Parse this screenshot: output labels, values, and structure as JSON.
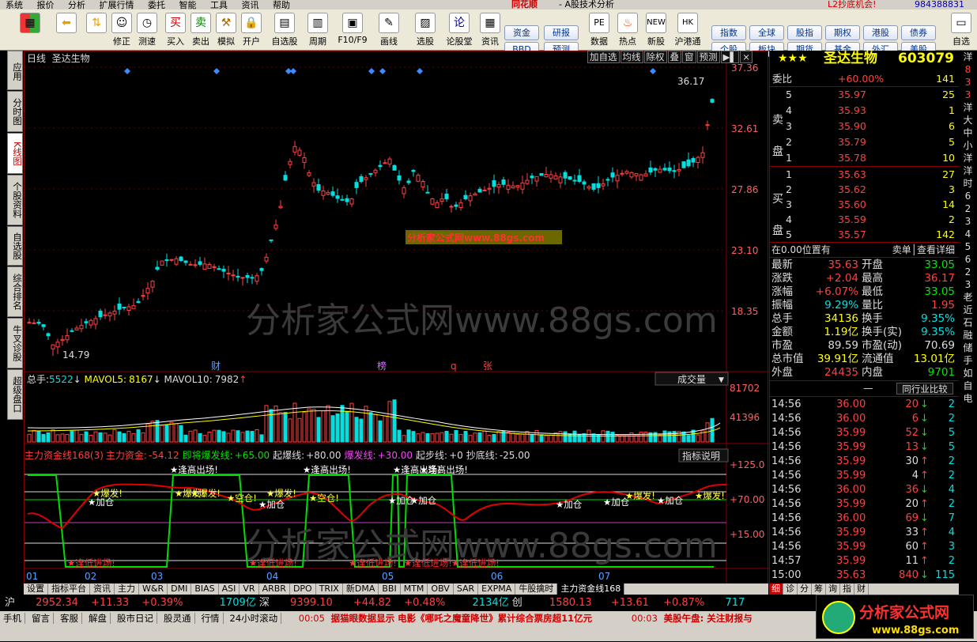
{
  "menubar": {
    "items": [
      "系统",
      "报价",
      "分析",
      "扩展行情",
      "委托",
      "智能",
      "工具",
      "资讯",
      "帮助"
    ],
    "app_title": "同花顺",
    "app_sub": "- A股技术分析",
    "promo": "L2抄底机会!",
    "phone": "984388831"
  },
  "toolbar": {
    "buttons": [
      "",
      "",
      "修正",
      "测速",
      "买入",
      "卖出",
      "模拟",
      "开户",
      "自选股",
      "周期",
      "F10/F9",
      "画线",
      "选股",
      "论股堂",
      "资讯",
      "数据",
      "热点",
      "新股",
      "沪港通",
      "自选"
    ],
    "small_buttons": [
      "资金",
      "研报",
      "BBD",
      "预测",
      "指数",
      "全球",
      "股指",
      "期权",
      "港股",
      "债券",
      "个股",
      "板块",
      "期货",
      "基金",
      "外汇",
      "美股"
    ]
  },
  "left_tabs": [
    "应用",
    "分时图",
    "K线图",
    "个股资料",
    "自选股",
    "综合排名",
    "牛叉诊股",
    "超级盘口"
  ],
  "chart": {
    "period": "日线",
    "stock_name": "圣达生物",
    "buttons": [
      "加自选",
      "均线",
      "除权",
      "叠",
      "窗",
      "预测"
    ],
    "price_axis": [
      "37.36",
      "32.61",
      "27.86",
      "23.10",
      "18.35"
    ],
    "high_label": "36.17",
    "low_label": "14.79",
    "event_tags": [
      "财",
      "榜",
      "q",
      "张"
    ],
    "watermark_small": "分析家公式网www.88gs.com",
    "watermark_big": "分析家公式网www.88gs.com",
    "volume_header": {
      "total_label": "总手:",
      "total": "5522",
      "ma5_label": "MAVOL5:",
      "ma5": "8167",
      "ma10_label": "MAVOL10:",
      "ma10": "7982"
    },
    "volume_dropdown": "成交量",
    "volume_axis": [
      "81702",
      "41396"
    ],
    "indicator_header": {
      "name": "主力资金线168(3)",
      "fund_label": "主力资金:",
      "fund": "-54.12",
      "about_label": "即将爆发线:",
      "about": "+65.00",
      "start_label": "起爆线:",
      "start": "+80.00",
      "burst_label": "爆发线:",
      "burst": "+30.00",
      "step_label": "起步线:",
      "step": "+0",
      "bottom_label": "抄底线:",
      "bottom": "-25.00"
    },
    "indicator_btn": "指标说明",
    "indicator_axis": [
      "+125.0",
      "+70.00",
      "+15.00"
    ],
    "signals": {
      "exit": "★逢高出场!",
      "enter": "★逢低进场!",
      "burst": "★爆发!",
      "add": "★加仓",
      "empty": "★空仓!"
    },
    "months": [
      "01",
      "02",
      "03",
      "04",
      "05",
      "06",
      "07"
    ]
  },
  "quote": {
    "stars": "★★★",
    "name": "圣达生物",
    "code": "603079",
    "weibi_label": "委比",
    "weibi": "+60.00%",
    "weibi_vol": "141",
    "sell_label": "卖盘",
    "buy_label": "买盘",
    "sells": [
      [
        "5",
        "35.97",
        "25"
      ],
      [
        "4",
        "35.93",
        "1"
      ],
      [
        "3",
        "35.90",
        "6"
      ],
      [
        "2",
        "35.79",
        "5"
      ],
      [
        "1",
        "35.78",
        "10"
      ]
    ],
    "buys": [
      [
        "1",
        "35.63",
        "27"
      ],
      [
        "2",
        "35.62",
        "3"
      ],
      [
        "3",
        "35.60",
        "14"
      ],
      [
        "4",
        "35.59",
        "2"
      ],
      [
        "5",
        "35.57",
        "142"
      ]
    ],
    "position_text": "在0.00位置有",
    "detail_text": "卖单│查看详细",
    "stats": [
      [
        "最新",
        "35.63",
        "开盘",
        "33.05"
      ],
      [
        "涨跌",
        "+2.04",
        "最高",
        "36.17"
      ],
      [
        "涨幅",
        "+6.07%",
        "最低",
        "33.05"
      ],
      [
        "振幅",
        "9.29%",
        "量比",
        "1.95"
      ],
      [
        "总手",
        "34136",
        "换手",
        "9.35%"
      ],
      [
        "金额",
        "1.19亿",
        "换手(实)",
        "9.35%"
      ],
      [
        "市盈",
        "89.59",
        "市盈(动)",
        "70.69"
      ],
      [
        "总市值",
        "39.91亿",
        "流通值",
        "13.01亿"
      ],
      [
        "外盘",
        "24435",
        "内盘",
        "9701"
      ]
    ],
    "industry_btn": "同行业比较",
    "ticks": [
      [
        "14:56",
        "36.00",
        "20",
        "↓",
        "2"
      ],
      [
        "14:56",
        "36.00",
        "6",
        "↓",
        "2"
      ],
      [
        "14:56",
        "35.99",
        "52",
        "↓",
        "5"
      ],
      [
        "14:56",
        "35.99",
        "13",
        "↓",
        "5"
      ],
      [
        "14:56",
        "35.99",
        "30",
        "↑",
        "2"
      ],
      [
        "14:56",
        "35.99",
        "4",
        "↑",
        "2"
      ],
      [
        "14:56",
        "36.00",
        "36",
        "↓",
        "4"
      ],
      [
        "14:56",
        "35.99",
        "20",
        "↑",
        "2"
      ],
      [
        "14:56",
        "36.00",
        "69",
        "↓",
        "7"
      ],
      [
        "14:56",
        "35.99",
        "33",
        "↑",
        "4"
      ],
      [
        "14:56",
        "35.99",
        "60",
        "↑",
        "3"
      ],
      [
        "14:57",
        "35.99",
        "11",
        "↑",
        "2"
      ],
      [
        "15:00",
        "35.63",
        "840",
        "↓",
        "115"
      ]
    ]
  },
  "scroll_col": [
    "洋",
    "8",
    "3",
    "3",
    "洋",
    "大",
    "中",
    "小",
    "洋",
    "洋",
    "时",
    "6",
    "2",
    "3",
    "4",
    "5",
    "6",
    "2",
    "3",
    "老",
    "近",
    "石",
    "融",
    "储",
    "手",
    "如",
    "自",
    "电"
  ],
  "bottom_tabs": [
    "设置",
    "指标平台",
    "资讯",
    "主力",
    "W&R",
    "DMI",
    "BIAS",
    "ASI",
    "VR",
    "ARBR",
    "DPO",
    "TRIX",
    "新DMA",
    "BBI",
    "MTM",
    "OBV",
    "SAR",
    "EXPMA",
    "牛股擒时",
    "主力资金线168"
  ],
  "right_tabs": [
    "细",
    "诊",
    "分",
    "筹",
    "询",
    "指",
    "财"
  ],
  "status1": {
    "sh": "沪",
    "sh_val": "2952.34",
    "sh_chg": "+11.33",
    "sh_pct": "+0.39%",
    "sh_amt": "1709亿",
    "sz": "深",
    "sz_val": "9399.10",
    "sz_chg": "+44.82",
    "sz_pct": "+0.48%",
    "sz_amt": "2134亿",
    "cy": "创",
    "cy_val": "1580.13",
    "cy_chg": "+13.61",
    "cy_pct": "+0.87%",
    "extra": "717"
  },
  "status2": {
    "items": [
      "手机",
      "留言",
      "客服",
      "解盘",
      "股市日记",
      "股灵通",
      "行情",
      "24小时滚动"
    ],
    "news1_time": "00:05",
    "news1": "据猫眼数据显示 电影《哪吒之魔童降世》累计综合票房超11亿元",
    "news2_time": "00:03",
    "news2": "美股午盘: 关注财报与"
  },
  "brand": {
    "name": "分析家公式网",
    "url": "www.88gs.com"
  },
  "colors": {
    "up": "#ff4040",
    "down": "#00e0e0",
    "ma": "#ffffff",
    "fund_line": "#e00000",
    "signal_line": "#00dd00"
  }
}
